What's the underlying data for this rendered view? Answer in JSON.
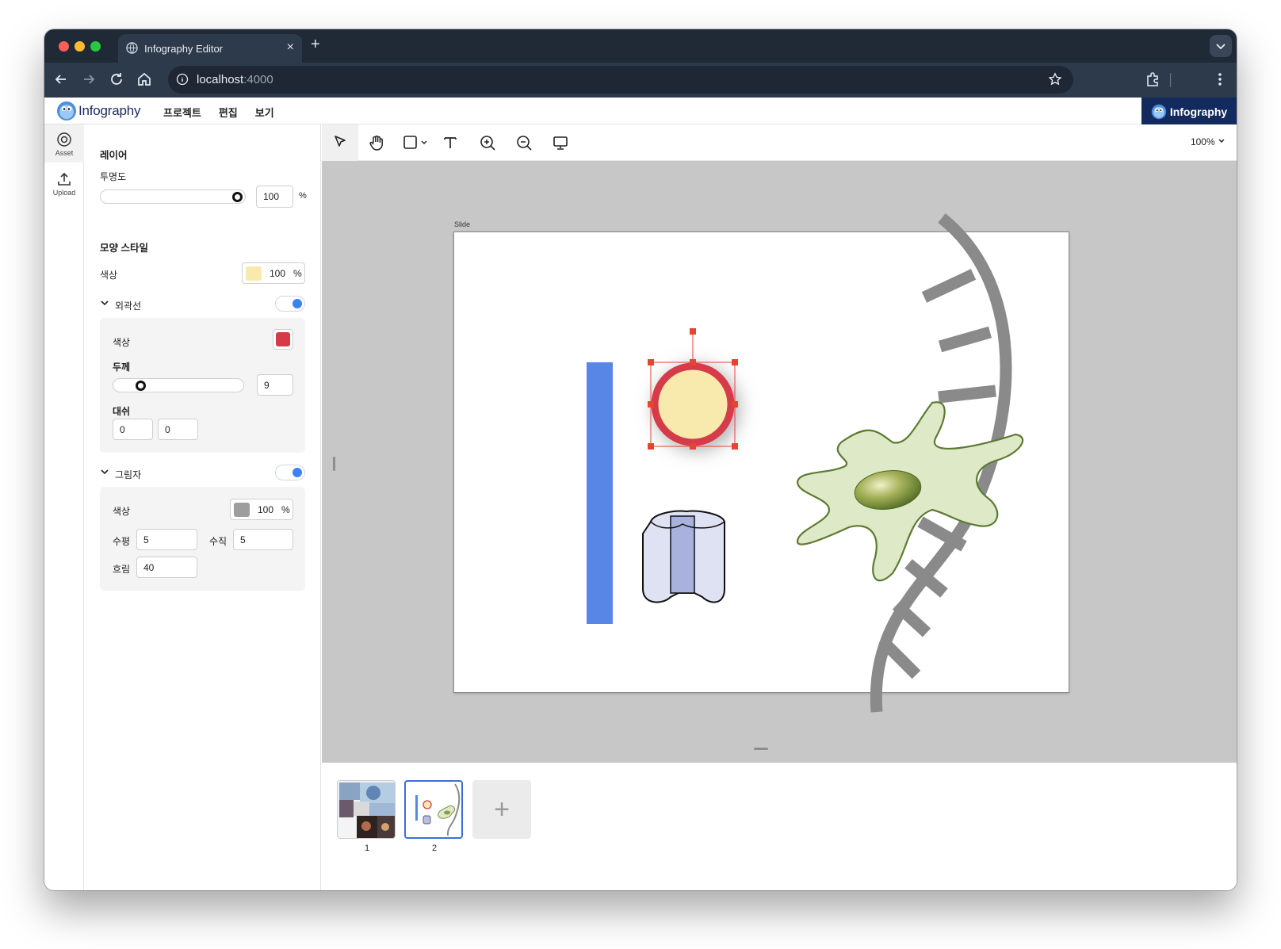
{
  "browser": {
    "tab_title": "Infography Editor",
    "tab_close": "×",
    "new_tab": "+",
    "url_host": "localhost",
    "url_port": ":4000"
  },
  "app": {
    "logo_text": "Infography",
    "brand_text": "Infography",
    "menu": [
      "프로젝트",
      "편집",
      "보기"
    ]
  },
  "rail": {
    "asset_label": "Asset",
    "upload_label": "Upload"
  },
  "panel": {
    "layer_title": "레이어",
    "opacity_label": "투명도",
    "opacity_value": "100",
    "opacity_unit": "%",
    "opacity_level": 1.0,
    "shape_style_title": "모양 스타일",
    "fill_label": "색상",
    "fill_color": "#f8e9ad",
    "fill_opacity": "100",
    "fill_unit": "%",
    "stroke_title": "외곽선",
    "stroke_enabled": true,
    "stroke_color_label": "색상",
    "stroke_color": "#d63a48",
    "stroke_width_label": "두께",
    "stroke_width": "9",
    "stroke_width_level": 0.2,
    "dash_label": "대쉬",
    "dash_values": [
      "0",
      "0"
    ],
    "shadow_title": "그림자",
    "shadow_enabled": true,
    "shadow_color_label": "색상",
    "shadow_color": "#9e9e9e",
    "shadow_opacity": "100",
    "shadow_unit": "%",
    "shadow_h_label": "수평",
    "shadow_h": "5",
    "shadow_v_label": "수직",
    "shadow_v": "5",
    "shadow_blur_label": "흐림",
    "shadow_blur": "40"
  },
  "toolbar": {
    "tools": [
      "select-tool",
      "hand-tool",
      "rectangle-tool",
      "text-tool",
      "zoom-in-tool",
      "zoom-out-tool",
      "present-tool"
    ],
    "zoom": "100%"
  },
  "canvas": {
    "slide_label": "Slide"
  },
  "slides": {
    "numbers": [
      "1",
      "2"
    ],
    "selected": "2",
    "add": "+"
  }
}
